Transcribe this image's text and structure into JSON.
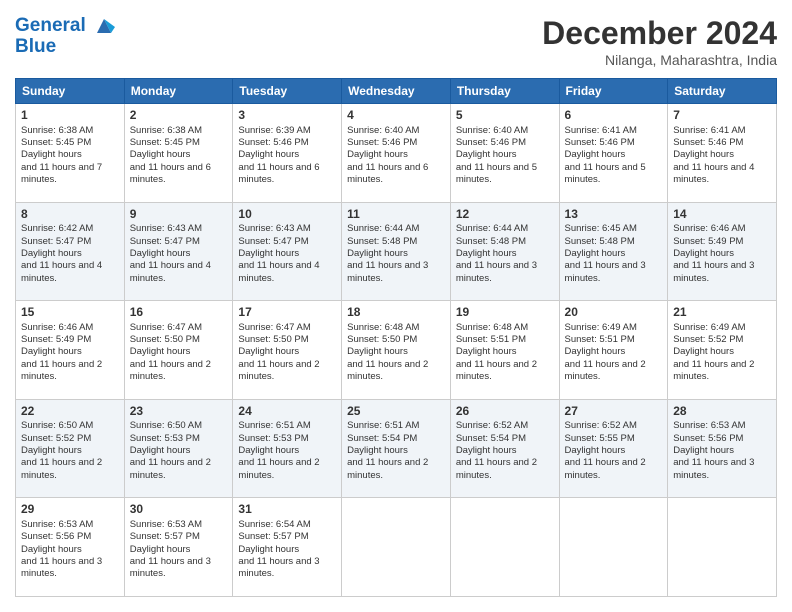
{
  "header": {
    "logo_line1": "General",
    "logo_line2": "Blue",
    "month_title": "December 2024",
    "location": "Nilanga, Maharashtra, India"
  },
  "days_of_week": [
    "Sunday",
    "Monday",
    "Tuesday",
    "Wednesday",
    "Thursday",
    "Friday",
    "Saturday"
  ],
  "weeks": [
    [
      {
        "day": "1",
        "sunrise": "6:38 AM",
        "sunset": "5:45 PM",
        "daylight": "11 hours and 7 minutes."
      },
      {
        "day": "2",
        "sunrise": "6:38 AM",
        "sunset": "5:45 PM",
        "daylight": "11 hours and 6 minutes."
      },
      {
        "day": "3",
        "sunrise": "6:39 AM",
        "sunset": "5:46 PM",
        "daylight": "11 hours and 6 minutes."
      },
      {
        "day": "4",
        "sunrise": "6:40 AM",
        "sunset": "5:46 PM",
        "daylight": "11 hours and 6 minutes."
      },
      {
        "day": "5",
        "sunrise": "6:40 AM",
        "sunset": "5:46 PM",
        "daylight": "11 hours and 5 minutes."
      },
      {
        "day": "6",
        "sunrise": "6:41 AM",
        "sunset": "5:46 PM",
        "daylight": "11 hours and 5 minutes."
      },
      {
        "day": "7",
        "sunrise": "6:41 AM",
        "sunset": "5:46 PM",
        "daylight": "11 hours and 4 minutes."
      }
    ],
    [
      {
        "day": "8",
        "sunrise": "6:42 AM",
        "sunset": "5:47 PM",
        "daylight": "11 hours and 4 minutes."
      },
      {
        "day": "9",
        "sunrise": "6:43 AM",
        "sunset": "5:47 PM",
        "daylight": "11 hours and 4 minutes."
      },
      {
        "day": "10",
        "sunrise": "6:43 AM",
        "sunset": "5:47 PM",
        "daylight": "11 hours and 4 minutes."
      },
      {
        "day": "11",
        "sunrise": "6:44 AM",
        "sunset": "5:48 PM",
        "daylight": "11 hours and 3 minutes."
      },
      {
        "day": "12",
        "sunrise": "6:44 AM",
        "sunset": "5:48 PM",
        "daylight": "11 hours and 3 minutes."
      },
      {
        "day": "13",
        "sunrise": "6:45 AM",
        "sunset": "5:48 PM",
        "daylight": "11 hours and 3 minutes."
      },
      {
        "day": "14",
        "sunrise": "6:46 AM",
        "sunset": "5:49 PM",
        "daylight": "11 hours and 3 minutes."
      }
    ],
    [
      {
        "day": "15",
        "sunrise": "6:46 AM",
        "sunset": "5:49 PM",
        "daylight": "11 hours and 2 minutes."
      },
      {
        "day": "16",
        "sunrise": "6:47 AM",
        "sunset": "5:50 PM",
        "daylight": "11 hours and 2 minutes."
      },
      {
        "day": "17",
        "sunrise": "6:47 AM",
        "sunset": "5:50 PM",
        "daylight": "11 hours and 2 minutes."
      },
      {
        "day": "18",
        "sunrise": "6:48 AM",
        "sunset": "5:50 PM",
        "daylight": "11 hours and 2 minutes."
      },
      {
        "day": "19",
        "sunrise": "6:48 AM",
        "sunset": "5:51 PM",
        "daylight": "11 hours and 2 minutes."
      },
      {
        "day": "20",
        "sunrise": "6:49 AM",
        "sunset": "5:51 PM",
        "daylight": "11 hours and 2 minutes."
      },
      {
        "day": "21",
        "sunrise": "6:49 AM",
        "sunset": "5:52 PM",
        "daylight": "11 hours and 2 minutes."
      }
    ],
    [
      {
        "day": "22",
        "sunrise": "6:50 AM",
        "sunset": "5:52 PM",
        "daylight": "11 hours and 2 minutes."
      },
      {
        "day": "23",
        "sunrise": "6:50 AM",
        "sunset": "5:53 PM",
        "daylight": "11 hours and 2 minutes."
      },
      {
        "day": "24",
        "sunrise": "6:51 AM",
        "sunset": "5:53 PM",
        "daylight": "11 hours and 2 minutes."
      },
      {
        "day": "25",
        "sunrise": "6:51 AM",
        "sunset": "5:54 PM",
        "daylight": "11 hours and 2 minutes."
      },
      {
        "day": "26",
        "sunrise": "6:52 AM",
        "sunset": "5:54 PM",
        "daylight": "11 hours and 2 minutes."
      },
      {
        "day": "27",
        "sunrise": "6:52 AM",
        "sunset": "5:55 PM",
        "daylight": "11 hours and 2 minutes."
      },
      {
        "day": "28",
        "sunrise": "6:53 AM",
        "sunset": "5:56 PM",
        "daylight": "11 hours and 3 minutes."
      }
    ],
    [
      {
        "day": "29",
        "sunrise": "6:53 AM",
        "sunset": "5:56 PM",
        "daylight": "11 hours and 3 minutes."
      },
      {
        "day": "30",
        "sunrise": "6:53 AM",
        "sunset": "5:57 PM",
        "daylight": "11 hours and 3 minutes."
      },
      {
        "day": "31",
        "sunrise": "6:54 AM",
        "sunset": "5:57 PM",
        "daylight": "11 hours and 3 minutes."
      },
      null,
      null,
      null,
      null
    ]
  ]
}
